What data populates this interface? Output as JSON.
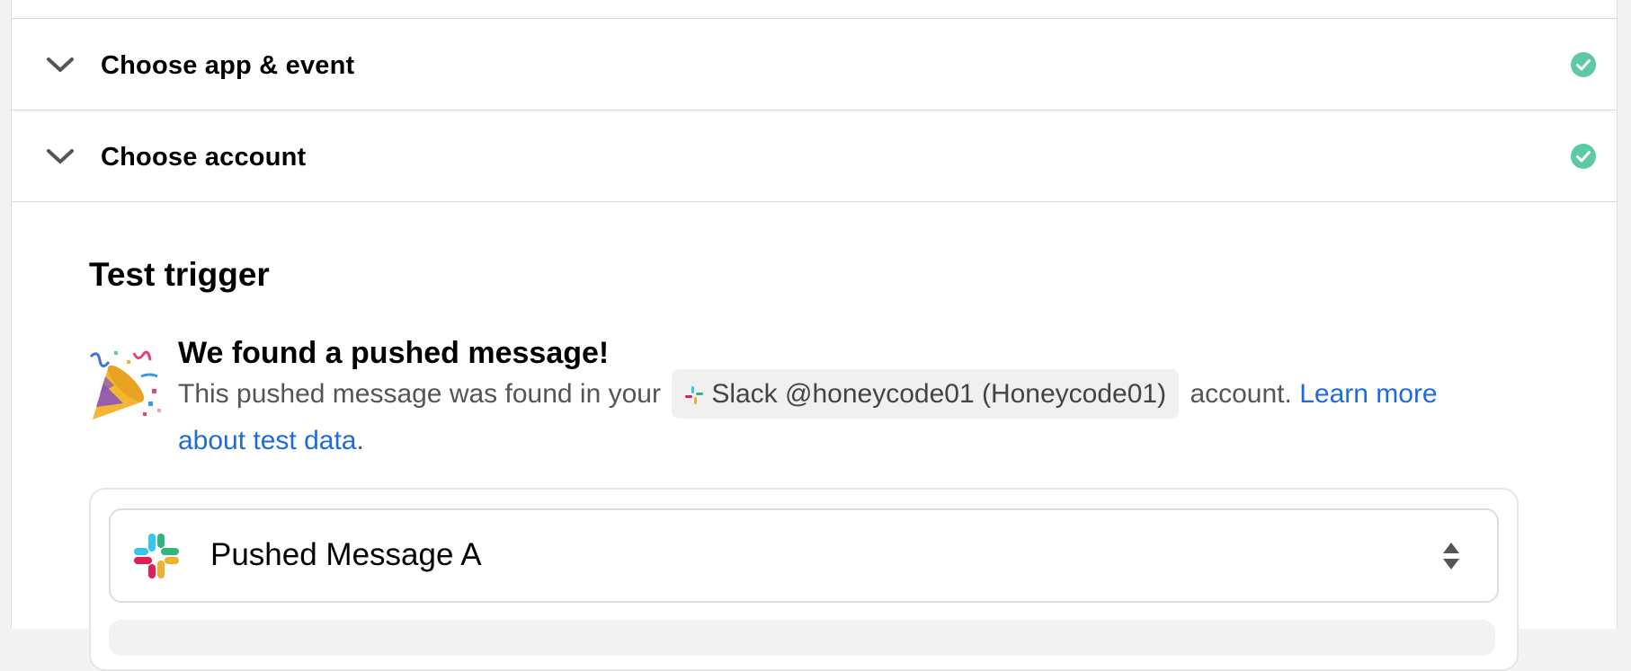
{
  "sections": [
    {
      "title": "Choose app & event",
      "status": "complete"
    },
    {
      "title": "Choose account",
      "status": "complete"
    }
  ],
  "test": {
    "heading": "Test trigger",
    "found_title": "We found a pushed message!",
    "found_text_before": "This pushed message was found in your",
    "account_chip": "Slack @honeycode01 (Honeycode01)",
    "found_text_after": "account.",
    "learn_more": "Learn more about test data",
    "period": "."
  },
  "selector": {
    "label": "Pushed Message A",
    "icon": "slack-logo-icon"
  },
  "colors": {
    "check_green": "#5cc9a7",
    "link_blue": "#1f6bdb",
    "chip_bg": "#f0f0f0",
    "border": "#d9d9d9"
  }
}
